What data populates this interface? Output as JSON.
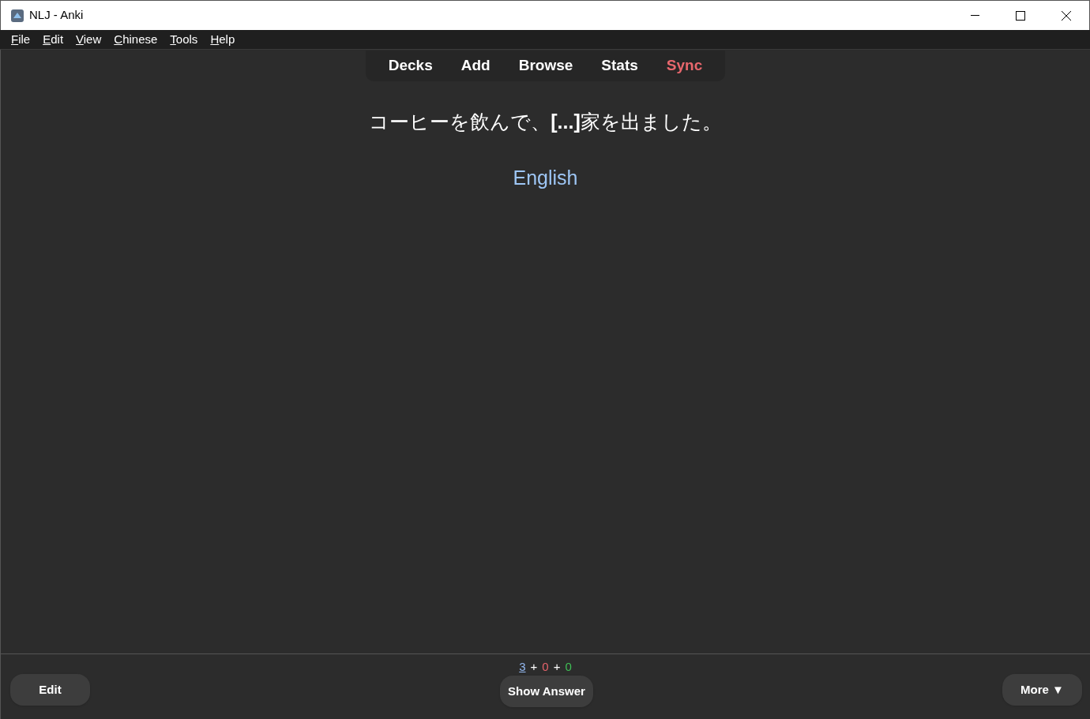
{
  "window": {
    "title": "NLJ - Anki"
  },
  "menu": [
    "File",
    "Edit",
    "View",
    "Chinese",
    "Tools",
    "Help"
  ],
  "toolbar": [
    {
      "label": "Decks",
      "kind": "normal"
    },
    {
      "label": "Add",
      "kind": "normal"
    },
    {
      "label": "Browse",
      "kind": "normal"
    },
    {
      "label": "Stats",
      "kind": "normal"
    },
    {
      "label": "Sync",
      "kind": "alert"
    }
  ],
  "card": {
    "sentence": "コーヒーを飲んで、**[...]**家を出ました。",
    "hint": "English"
  },
  "counts": [
    {
      "text": "3",
      "color": "#93b8f0",
      "current": true
    },
    {
      "text": "+",
      "color": "#ffffff",
      "current": false
    },
    {
      "text": "0",
      "color": "#e5636b",
      "current": false
    },
    {
      "text": "+",
      "color": "#ffffff",
      "current": false
    },
    {
      "text": "0",
      "color": "#3fbf55",
      "current": false
    }
  ],
  "buttons": {
    "edit": "Edit",
    "answer": "Show Answer",
    "more": "More ▼"
  }
}
